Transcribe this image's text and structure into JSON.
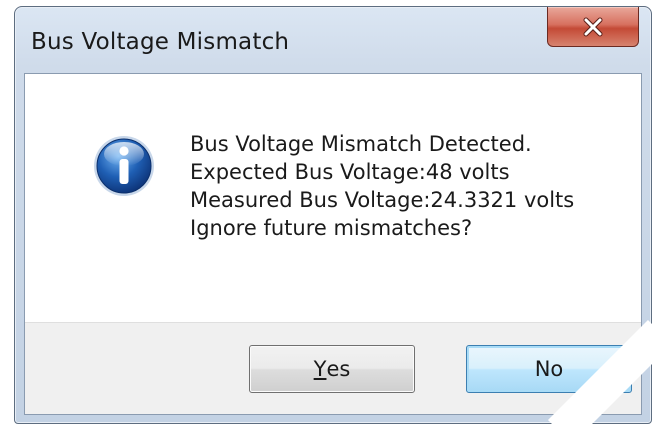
{
  "dialog": {
    "title": "Bus Voltage Mismatch",
    "close_icon": "close-x-icon",
    "message_icon": "information-icon",
    "message_lines": [
      "Bus Voltage Mismatch Detected.",
      "Expected Bus Voltage:48 volts",
      "Measured Bus Voltage:24.3321 volts",
      "Ignore future mismatches?"
    ],
    "buttons": {
      "yes_mnemonic": "Y",
      "yes_rest": "es",
      "no_label": "No"
    }
  },
  "colors": {
    "close_button": "#c44a36",
    "info_icon_blue": "#1f5fb4",
    "default_button_border": "#3c7fb1"
  }
}
